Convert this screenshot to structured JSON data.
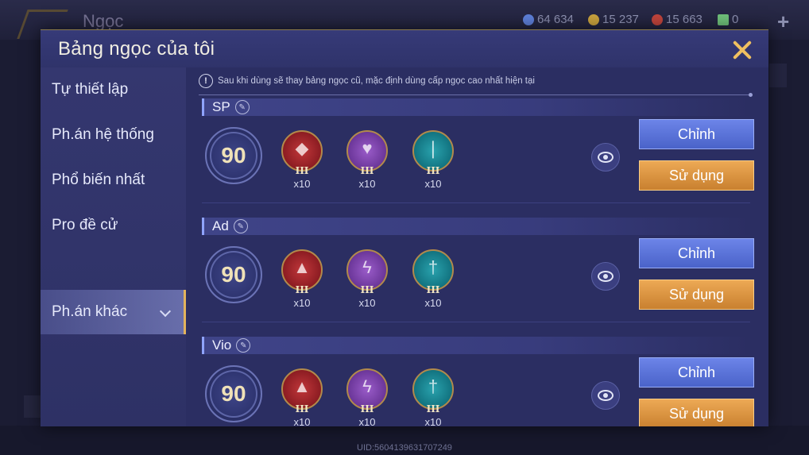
{
  "background": {
    "title": "Ngọc",
    "resources": [
      {
        "icon": "blue-gem-icon",
        "value": "64 634",
        "color": "#5d7fd8"
      },
      {
        "icon": "gold-coin-icon",
        "value": "15 237",
        "color": "#c9a23e"
      },
      {
        "icon": "red-gem-icon",
        "value": "15 663",
        "color": "#c0443c"
      },
      {
        "icon": "voucher-icon",
        "value": "0",
        "color": "#6fbf7a"
      }
    ],
    "uid": "UID:5604139631707249"
  },
  "modal": {
    "title": "Bảng ngọc của tôi",
    "notice": "Sau khi dùng sẽ thay bảng ngọc cũ, mặc định dùng cấp ngọc cao nhất hiện tại"
  },
  "sidebar": {
    "items": [
      {
        "label": "Tự thiết lập",
        "active": false
      },
      {
        "label": "Ph.án hệ thống",
        "active": false
      },
      {
        "label": "Phổ biến nhất",
        "active": false
      },
      {
        "label": "Pro đề cử",
        "active": false
      },
      {
        "label": "Ph.án khác",
        "active": true
      }
    ]
  },
  "pages": [
    {
      "name": "SP",
      "level": "90",
      "gems": [
        {
          "color": "red",
          "tier": "III",
          "count": "x10"
        },
        {
          "color": "purple",
          "tier": "III",
          "count": "x10"
        },
        {
          "color": "teal",
          "tier": "III",
          "count": "x10"
        }
      ],
      "edit_label": "Chỉnh",
      "use_label": "Sử dụng"
    },
    {
      "name": "Ad",
      "level": "90",
      "gems": [
        {
          "color": "red",
          "tier": "III",
          "count": "x10"
        },
        {
          "color": "purple",
          "tier": "III",
          "count": "x10"
        },
        {
          "color": "teal",
          "tier": "III",
          "count": "x10"
        }
      ],
      "edit_label": "Chỉnh",
      "use_label": "Sử dụng"
    },
    {
      "name": "Vio",
      "level": "90",
      "gems": [
        {
          "color": "red",
          "tier": "III",
          "count": "x10"
        },
        {
          "color": "purple",
          "tier": "III",
          "count": "x10"
        },
        {
          "color": "teal",
          "tier": "III",
          "count": "x10"
        }
      ],
      "edit_label": "Chỉnh",
      "use_label": "Sử dụng"
    }
  ],
  "colors": {
    "accent": "#e3b35c",
    "edit_button": "#5b74d8",
    "use_button": "#e09a47",
    "close": "#f0c060"
  }
}
